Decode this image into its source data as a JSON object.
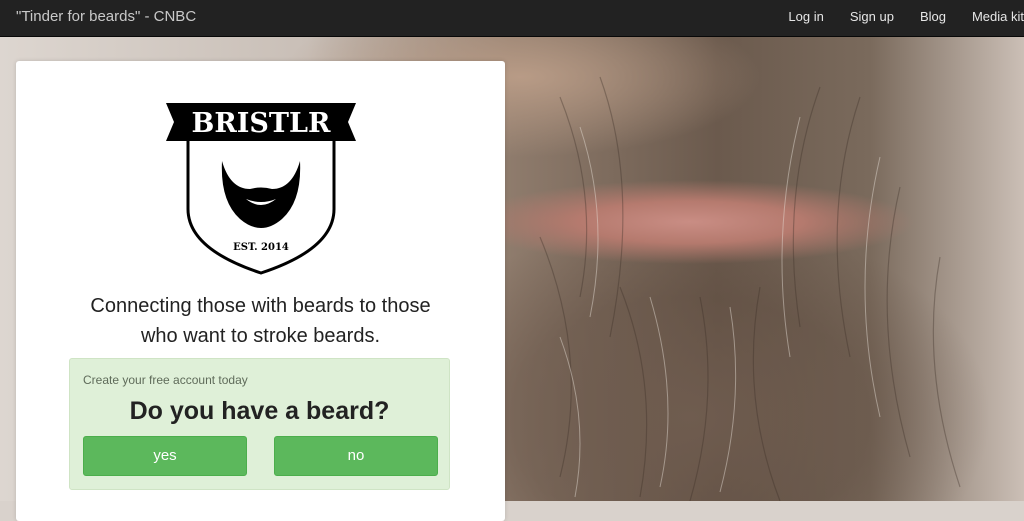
{
  "navbar": {
    "brand": "\"Tinder for beards\" - CNBC",
    "links": [
      {
        "label": "Log in"
      },
      {
        "label": "Sign up"
      },
      {
        "label": "Blog"
      },
      {
        "label": "Media kit"
      }
    ]
  },
  "card": {
    "logo": {
      "name": "BRISTLR",
      "est": "EST. 2014"
    },
    "tagline_line1": "Connecting those with beards to those",
    "tagline_line2": "who want to stroke beards.",
    "signup": {
      "subtitle": "Create your free account today",
      "question": "Do you have a beard?",
      "yes_label": "yes",
      "no_label": "no"
    }
  },
  "colors": {
    "navbar_bg": "#222222",
    "button_green": "#5cb85c",
    "panel_green": "#dff0d8"
  }
}
